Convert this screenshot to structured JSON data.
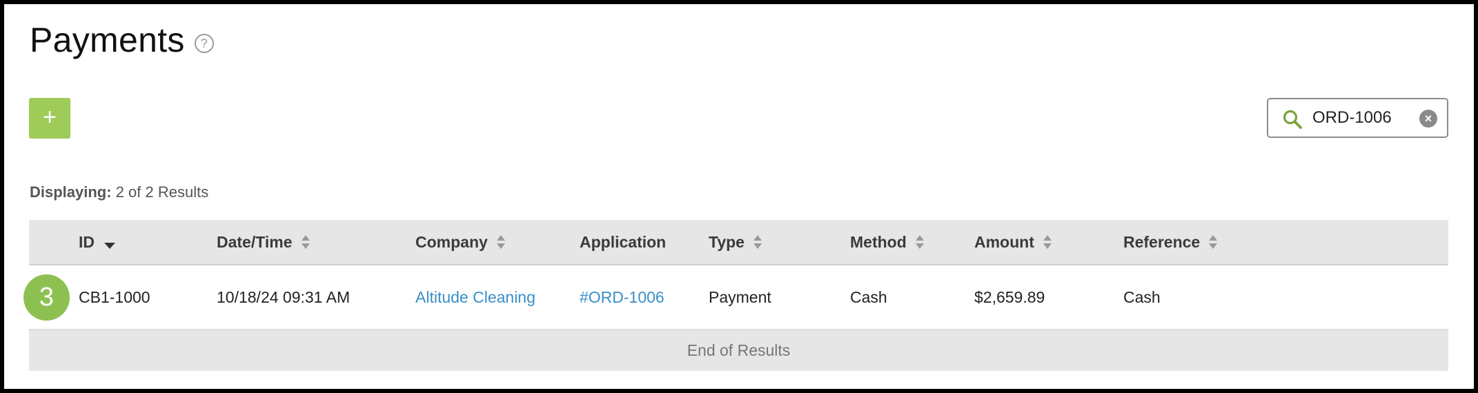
{
  "page": {
    "title": "Payments",
    "help_icon": "?"
  },
  "toolbar": {
    "add_label": "+",
    "search": {
      "value": "ORD-1006",
      "placeholder": "",
      "clear_icon": "×"
    }
  },
  "results": {
    "label": "Displaying:",
    "summary": "2 of 2 Results"
  },
  "table": {
    "columns": [
      {
        "label": "ID",
        "sort": "desc"
      },
      {
        "label": "Date/Time",
        "sort": "both"
      },
      {
        "label": "Company",
        "sort": "both"
      },
      {
        "label": "Application",
        "sort": "none"
      },
      {
        "label": "Type",
        "sort": "both"
      },
      {
        "label": "Method",
        "sort": "both"
      },
      {
        "label": "Amount",
        "sort": "both"
      },
      {
        "label": "Reference",
        "sort": "both"
      }
    ],
    "rows": [
      {
        "badge": "3",
        "id": "CB1-1000",
        "datetime": "10/18/24 09:31 AM",
        "company": "Altitude Cleaning",
        "application": "#ORD-1006",
        "type": "Payment",
        "method": "Cash",
        "amount": "$2,659.89",
        "reference": "Cash"
      }
    ],
    "footer": "End of Results"
  },
  "colors": {
    "accent_green": "#9fcb58",
    "badge_green": "#8cc152",
    "link_blue": "#3a8ec9",
    "header_gray": "#e6e6e6"
  }
}
